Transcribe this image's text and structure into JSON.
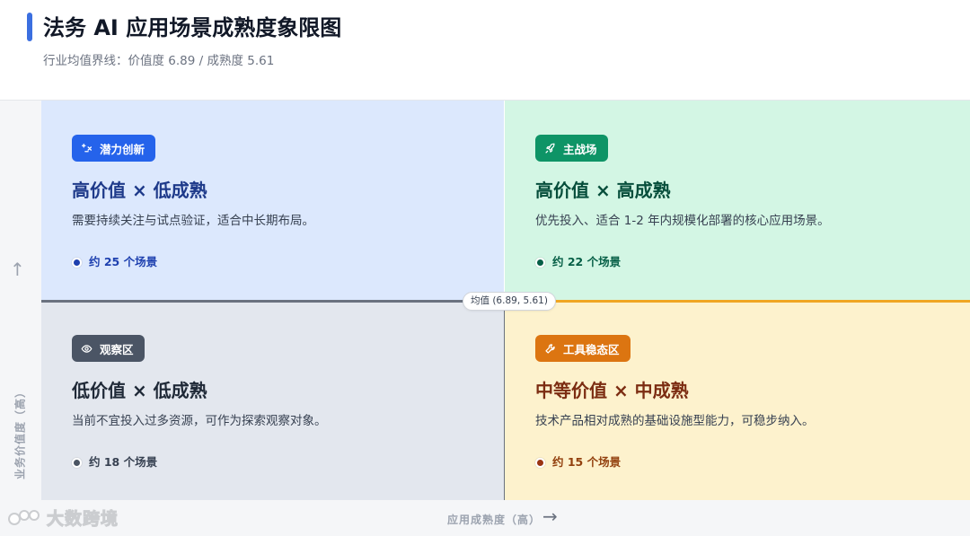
{
  "header": {
    "title": "法务 AI 应用场景成熟度象限图",
    "subtitle": "行业均值界线：价值度 6.89 / 成熟度 5.61"
  },
  "axes": {
    "y_label": "业务价值度（高）",
    "y_arrow": "↑",
    "x_label": "应用成熟度（高）",
    "x_arrow": "→"
  },
  "mean_marker": "均值 (6.89, 5.61)",
  "quadrants": {
    "top_left": {
      "badge": "潜力创新",
      "icon": "sparkle-icon",
      "title": "高价值 × 低成熟",
      "description": "需要持续关注与试点验证，适合中长期布局。",
      "count": "约 25 个场景",
      "color": "#2563eb"
    },
    "top_right": {
      "badge": "主战场",
      "icon": "rocket-icon",
      "title": "高价值 × 高成熟",
      "description": "优先投入、适合 1-2 年内规模化部署的核心应用场景。",
      "count": "约 22 个场景",
      "color": "#0e9466"
    },
    "bottom_left": {
      "badge": "观察区",
      "icon": "eye-icon",
      "title": "低价值 × 低成熟",
      "description": "当前不宜投入过多资源，可作为探索观察对象。",
      "count": "约 18 个场景",
      "color": "#4b5565"
    },
    "bottom_right": {
      "badge": "工具稳态区",
      "icon": "wrench-icon",
      "title": "中等价值 × 中成熟",
      "description": "技术产品相对成熟的基础设施型能力，可稳步纳入。",
      "count": "约 15 个场景",
      "color": "#dc7511"
    }
  },
  "watermark": "大数跨境"
}
